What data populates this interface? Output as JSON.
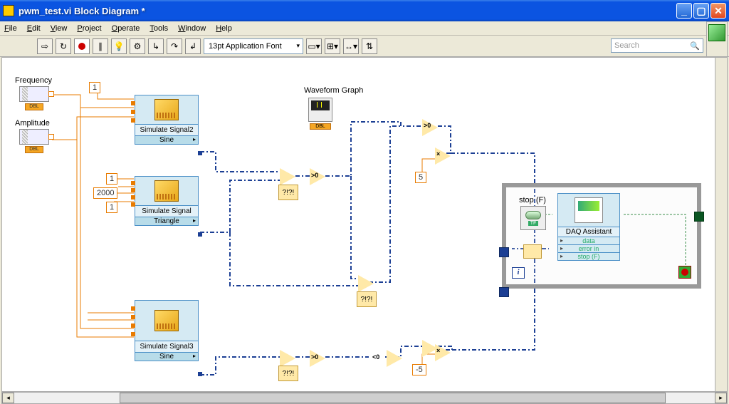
{
  "titlebar": {
    "text": "pwm_test.vi Block Diagram *"
  },
  "menu": {
    "file": "File",
    "edit": "Edit",
    "view": "View",
    "project": "Project",
    "operate": "Operate",
    "tools": "Tools",
    "window": "Window",
    "help": "Help"
  },
  "toolbar": {
    "font": "13pt Application Font",
    "search_placeholder": "Search",
    "help": "?"
  },
  "controls": {
    "frequency": {
      "label": "Frequency",
      "dbl": "DBL"
    },
    "amplitude": {
      "label": "Amplitude",
      "dbl": "DBL"
    }
  },
  "constants": {
    "c1": "1",
    "c2": "1",
    "c3": "2000",
    "c4": "1",
    "c5": "5",
    "c6": "-5"
  },
  "sim": {
    "s1": {
      "name": "Simulate Signal2",
      "type": "Sine"
    },
    "s2": {
      "name": "Simulate Signal",
      "type": "Triangle"
    },
    "s3": {
      "name": "Simulate Signal3",
      "type": "Sine"
    }
  },
  "graph": {
    "label": "Waveform Graph",
    "dbl": "DBL"
  },
  "daq": {
    "name": "DAQ Assistant",
    "row1": "data",
    "row2": "error in",
    "row3": "stop (F)"
  },
  "stopctrl": {
    "label": "stop (F)",
    "tf": "TF"
  },
  "loop": {
    "i": "i"
  },
  "fn": {
    "gt": ">0",
    "lt": "<0",
    "qr": "?!?!",
    "mul": "×"
  }
}
